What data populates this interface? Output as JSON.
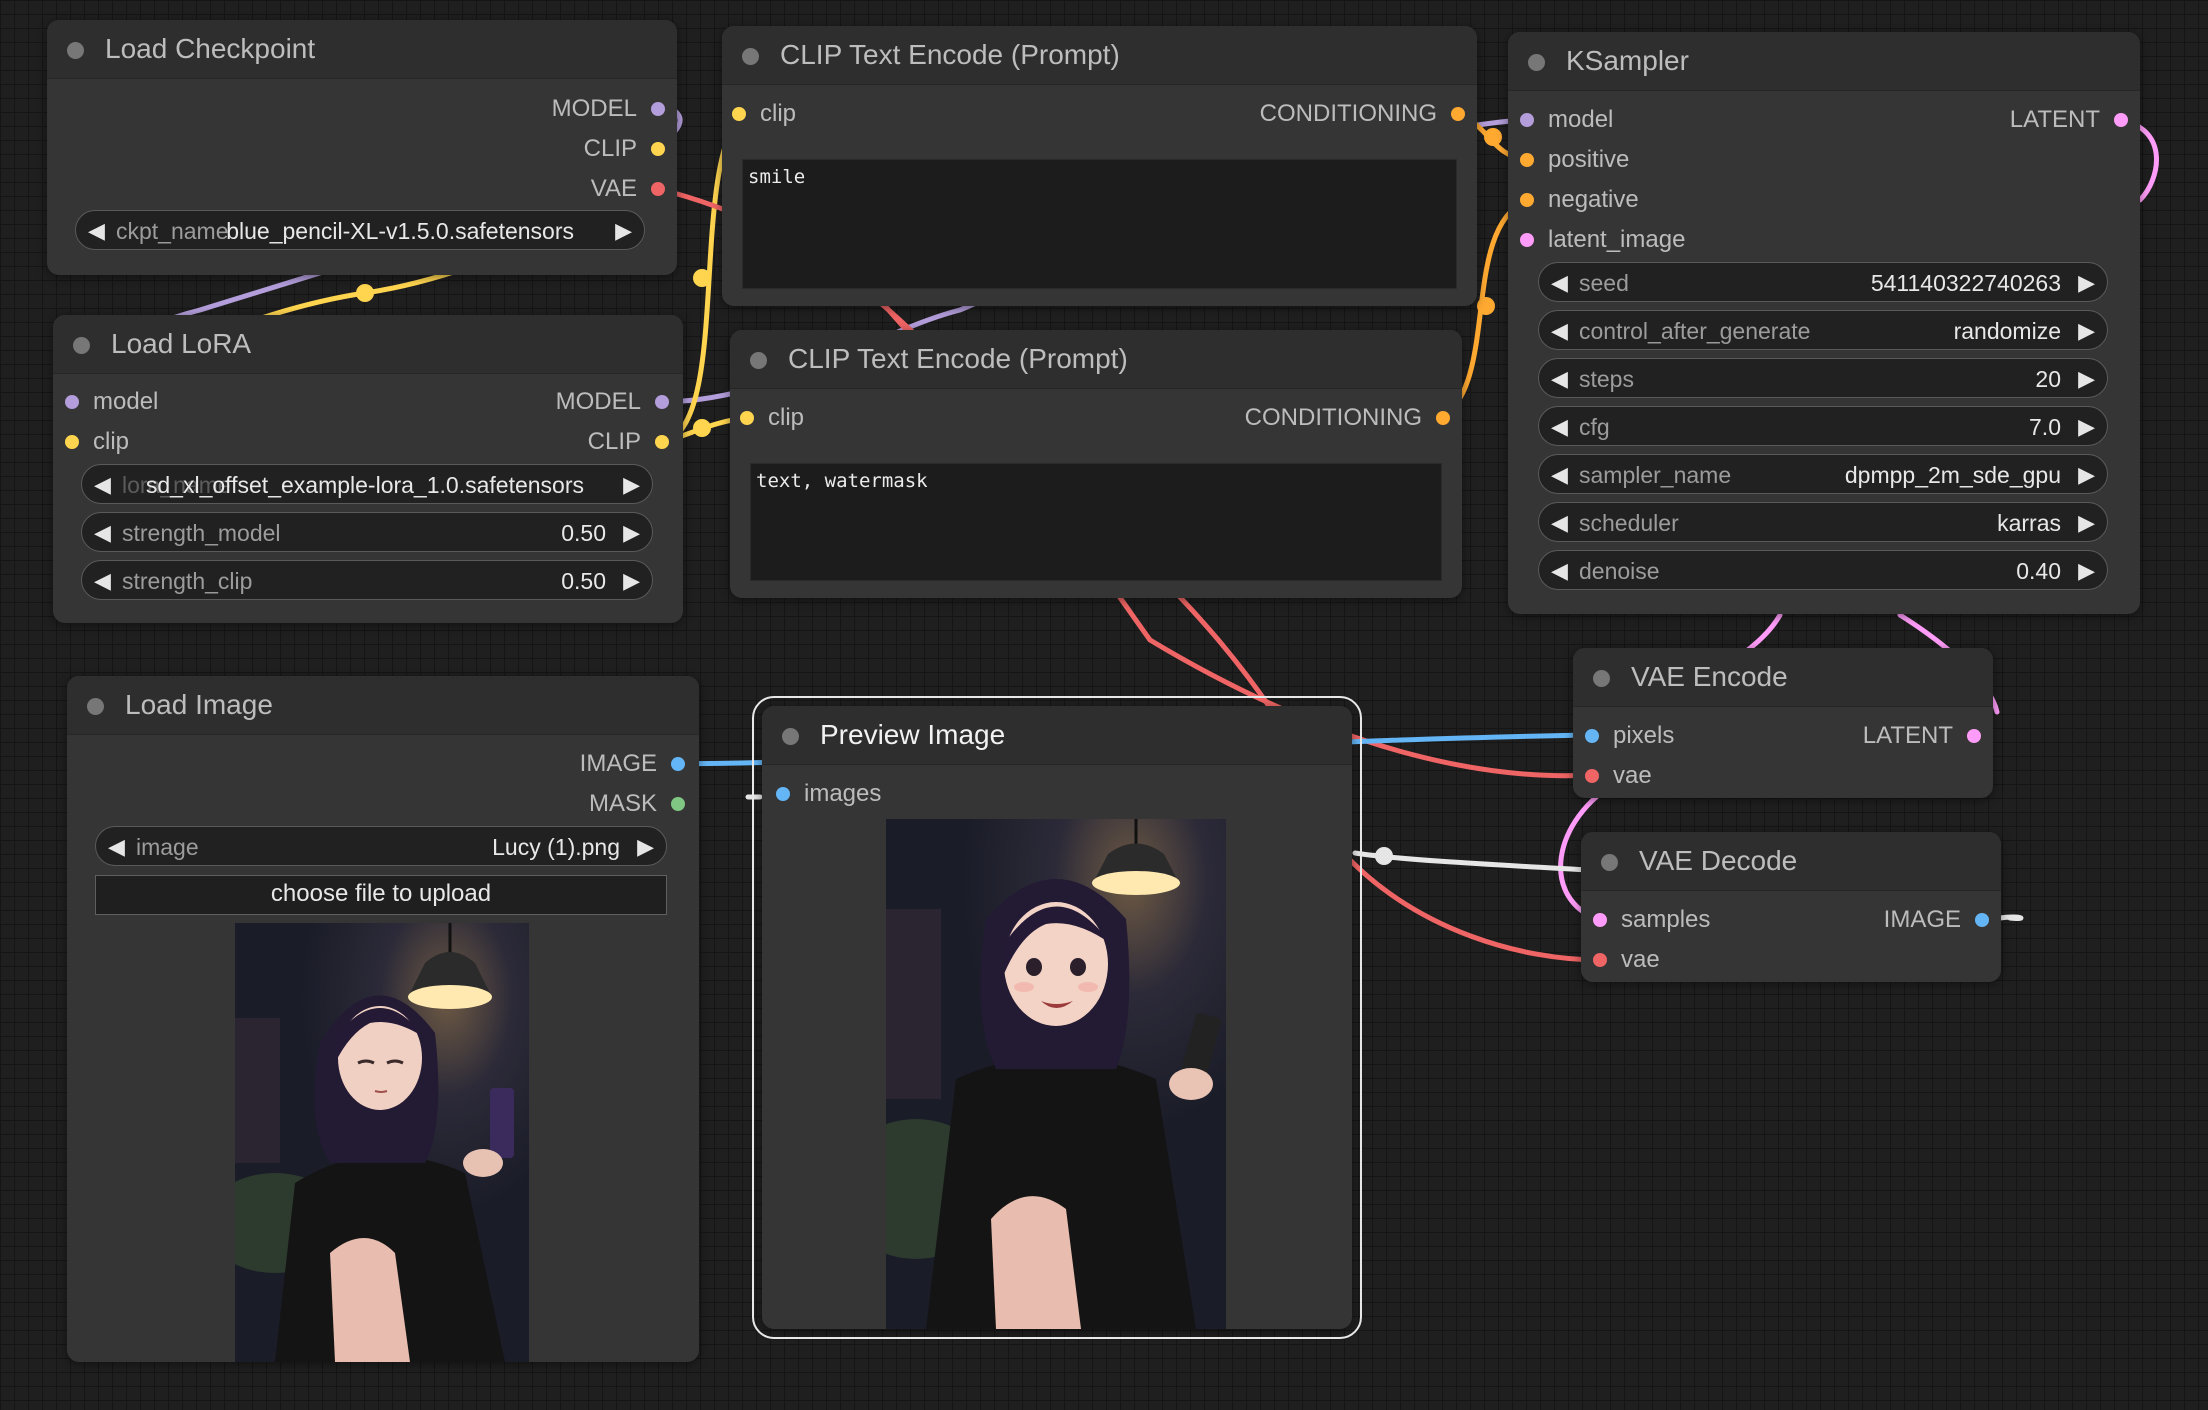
{
  "colors": {
    "model": "#b39ddb",
    "clip": "#ffd54f",
    "vae": "#ef6464",
    "conditioning": "#ffa931",
    "latent": "#ff9cf9",
    "image": "#64b5f6",
    "mask": "#81c784"
  },
  "load_checkpoint": {
    "title": "Load Checkpoint",
    "outputs": [
      "MODEL",
      "CLIP",
      "VAE"
    ],
    "ckpt_name_label": "ckpt_name",
    "ckpt_name_value": "blue_pencil-XL-v1.5.0.safetensors"
  },
  "clip_encode_positive": {
    "title": "CLIP Text Encode (Prompt)",
    "input": "clip",
    "output": "CONDITIONING",
    "text": "smile"
  },
  "clip_encode_negative": {
    "title": "CLIP Text Encode (Prompt)",
    "input": "clip",
    "output": "CONDITIONING",
    "text": "text, watermask"
  },
  "ksampler": {
    "title": "KSampler",
    "inputs": [
      "model",
      "positive",
      "negative",
      "latent_image"
    ],
    "output": "LATENT",
    "widgets": [
      {
        "label": "seed",
        "value": "541140322740263"
      },
      {
        "label": "control_after_generate",
        "value": "randomize"
      },
      {
        "label": "steps",
        "value": "20"
      },
      {
        "label": "cfg",
        "value": "7.0"
      },
      {
        "label": "sampler_name",
        "value": "dpmpp_2m_sde_gpu"
      },
      {
        "label": "scheduler",
        "value": "karras"
      },
      {
        "label": "denoise",
        "value": "0.40"
      }
    ]
  },
  "load_lora": {
    "title": "Load LoRA",
    "inputs": [
      "model",
      "clip"
    ],
    "outputs": [
      "MODEL",
      "CLIP"
    ],
    "widgets": [
      {
        "label": "lora_name",
        "value": "sd_xl_offset_example-lora_1.0.safetensors"
      },
      {
        "label": "strength_model",
        "value": "0.50"
      },
      {
        "label": "strength_clip",
        "value": "0.50"
      }
    ]
  },
  "load_image": {
    "title": "Load Image",
    "outputs": [
      "IMAGE",
      "MASK"
    ],
    "image_label": "image",
    "image_value": "Lucy (1).png",
    "upload_label": "choose file to upload"
  },
  "preview_image": {
    "title": "Preview Image",
    "input": "images"
  },
  "vae_encode": {
    "title": "VAE Encode",
    "inputs": [
      "pixels",
      "vae"
    ],
    "output": "LATENT"
  },
  "vae_decode": {
    "title": "VAE Decode",
    "inputs": [
      "samples",
      "vae"
    ],
    "output": "IMAGE"
  }
}
